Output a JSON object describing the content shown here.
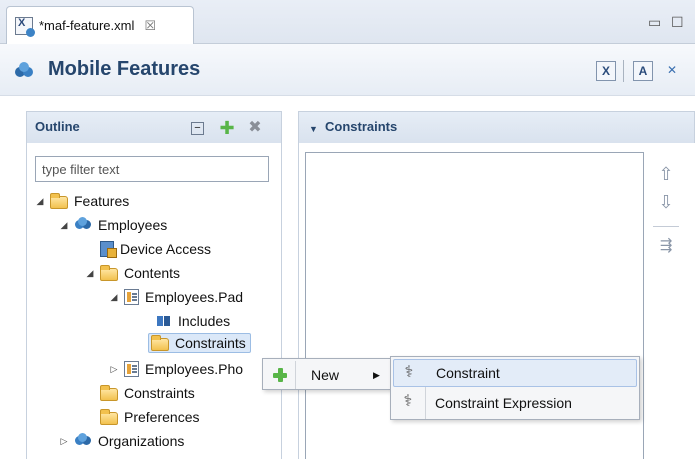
{
  "editor_tab": {
    "title": "*maf-feature.xml",
    "close_glyph": "☒"
  },
  "window_controls": {
    "minimize": "▭",
    "maximize": "☐"
  },
  "header": {
    "title": "Mobile Features",
    "buttons": [
      {
        "name": "xml-view-button",
        "glyph": "X"
      },
      {
        "name": "design-view-button",
        "glyph": "A"
      },
      {
        "name": "overview-button",
        "glyph": "✕"
      }
    ]
  },
  "outline": {
    "title": "Outline",
    "filter_placeholder": "type filter text",
    "tree": [
      {
        "label": "Features",
        "icon": "folder-icon",
        "expanded": true
      },
      {
        "label": "Employees",
        "icon": "feature-icon",
        "expanded": true
      },
      {
        "label": "Device Access",
        "icon": "device-access-icon"
      },
      {
        "label": "Contents",
        "icon": "folder-icon",
        "expanded": true
      },
      {
        "label": "Employees.Pad",
        "icon": "content-icon",
        "expanded": true
      },
      {
        "label": "Includes",
        "icon": "includes-icon"
      },
      {
        "label": "Constraints",
        "icon": "folder-icon",
        "selected": true
      },
      {
        "label": "Employees.Pho",
        "icon": "content-icon",
        "expanded": false
      },
      {
        "label": "Constraints",
        "icon": "folder-icon"
      },
      {
        "label": "Preferences",
        "icon": "folder-icon"
      },
      {
        "label": "Organizations",
        "icon": "feature-icon",
        "expanded": false
      }
    ]
  },
  "constraints_panel": {
    "title": "Constraints"
  },
  "context_menu": {
    "items": [
      {
        "label": "New",
        "submenu_arrow": "▶"
      }
    ],
    "submenu": [
      {
        "label": "Constraint",
        "highlighted": true
      },
      {
        "label": "Constraint Expression"
      }
    ]
  },
  "colors": {
    "header_title": "#26466d",
    "selection_bg": "#dbe8f8",
    "add_icon": "#58b548"
  }
}
